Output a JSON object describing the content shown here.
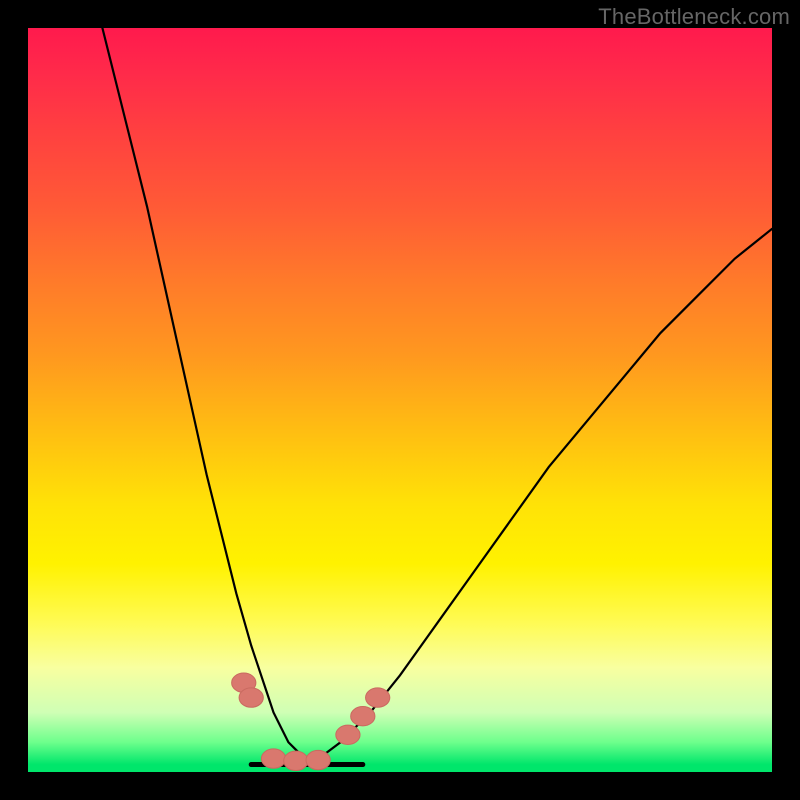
{
  "watermark": "TheBottleneck.com",
  "chart_data": {
    "type": "line",
    "title": "",
    "xlabel": "",
    "ylabel": "",
    "xlim": [
      0,
      100
    ],
    "ylim": [
      0,
      100
    ],
    "series": [
      {
        "name": "left-curve",
        "x": [
          10,
          12,
          14,
          16,
          18,
          20,
          22,
          24,
          26,
          28,
          30,
          32,
          33,
          34,
          35,
          36,
          37,
          38
        ],
        "values": [
          100,
          92,
          84,
          76,
          67,
          58,
          49,
          40,
          32,
          24,
          17,
          11,
          8,
          6,
          4,
          3,
          2,
          1
        ]
      },
      {
        "name": "right-curve",
        "x": [
          38,
          42,
          46,
          50,
          55,
          60,
          65,
          70,
          75,
          80,
          85,
          90,
          95,
          100
        ],
        "values": [
          1,
          4,
          8,
          13,
          20,
          27,
          34,
          41,
          47,
          53,
          59,
          64,
          69,
          73
        ]
      },
      {
        "name": "flat-bottom",
        "x": [
          30,
          45
        ],
        "values": [
          1,
          1
        ]
      }
    ],
    "markers": [
      {
        "name": "left-cluster-upper",
        "cx": 29,
        "cy": 12,
        "r": 1.3
      },
      {
        "name": "left-cluster-lower",
        "cx": 30,
        "cy": 10,
        "r": 1.3
      },
      {
        "name": "bottom-cap-1",
        "cx": 33,
        "cy": 1.8,
        "r": 1.3
      },
      {
        "name": "bottom-cap-2",
        "cx": 36,
        "cy": 1.5,
        "r": 1.3
      },
      {
        "name": "bottom-cap-3",
        "cx": 39,
        "cy": 1.6,
        "r": 1.3
      },
      {
        "name": "right-cluster-1",
        "cx": 43,
        "cy": 5,
        "r": 1.3
      },
      {
        "name": "right-cluster-2",
        "cx": 45,
        "cy": 7.5,
        "r": 1.3
      },
      {
        "name": "right-cluster-3",
        "cx": 47,
        "cy": 10,
        "r": 1.3
      }
    ],
    "colors": {
      "curve": "#000000",
      "marker_fill": "#d9786e",
      "marker_stroke": "#c96a60",
      "gradient_top": "#ff1a4d",
      "gradient_mid": "#fff200",
      "gradient_bottom": "#00e66b"
    }
  }
}
